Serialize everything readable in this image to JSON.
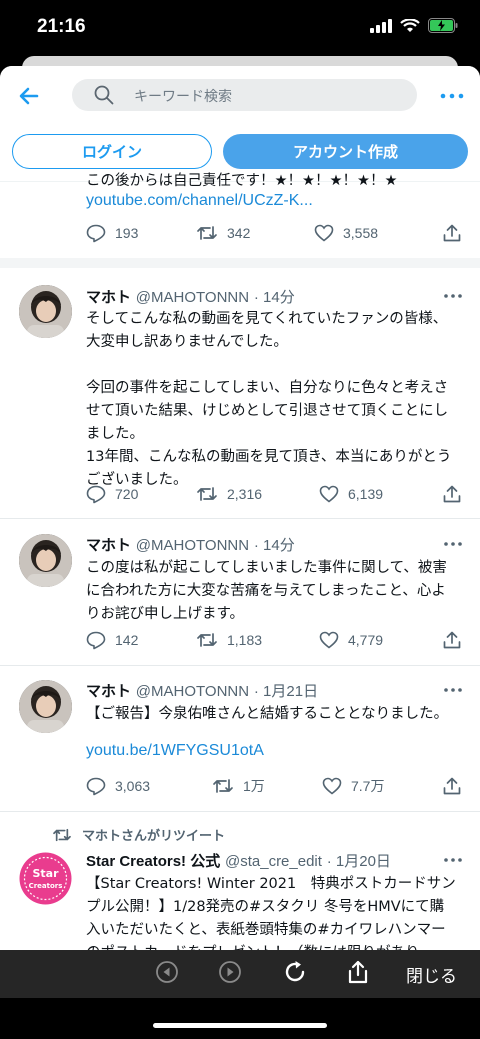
{
  "status_bar": {
    "time": "21:16"
  },
  "header": {
    "search_placeholder": "キーワード検索"
  },
  "auth": {
    "login_label": "ログイン",
    "signup_label": "アカウント作成"
  },
  "partial_tweet": {
    "text_fragment": "この後からは自己責任です！★！★！★！★！★",
    "link": "youtube.com/channel/UCzZ-K...",
    "replies": "193",
    "retweets": "342",
    "likes": "3,558"
  },
  "tweets": [
    {
      "name": "マホト",
      "handle": "@MAHOTONNN",
      "time": "· 14分",
      "text": "そしてこんな私の動画を見てくれていたファンの皆様、大変申し訳ありませんでした。\n\n今回の事件を起こしてしまい、自分なりに色々と考えさせて頂いた結果、けじめとして引退させて頂くことにしました。\n13年間、こんな私の動画を見て頂き、本当にありがとうございました。",
      "replies": "720",
      "retweets": "2,316",
      "likes": "6,139"
    },
    {
      "name": "マホト",
      "handle": "@MAHOTONNN",
      "time": "· 14分",
      "text": "この度は私が起こしてしまいました事件に関して、被害に合われた方に大変な苦痛を与えてしまったこと、心よりお詫び申し上げます。",
      "replies": "142",
      "retweets": "1,183",
      "likes": "4,779"
    },
    {
      "name": "マホト",
      "handle": "@MAHOTONNN",
      "time": "· 1月21日",
      "text": "【ご報告】今泉佑唯さんと結婚することとなりました。",
      "link": "youtu.be/1WFYGSU1otA",
      "replies": "3,063",
      "retweets": "1万",
      "likes": "7.7万"
    },
    {
      "retweet_note": "マホトさんがリツイート",
      "name": "Star Creators! 公式",
      "handle": "@sta_cre_edit",
      "time": "· 1月20日",
      "avatar_text": "Star Creators",
      "text": "【Star Creators! Winter 2021　特典ポストカードサンプル公開！】1/28発売の#スタクリ 冬号をHMVにて購入いただいたくと、表紙巻頭特集の#カイワレハンマー のポストカードをプレゼント！（数には限りがあり"
    }
  ],
  "toolbar": {
    "close_label": "閉じる"
  },
  "colors": {
    "accent": "#1d9bf0",
    "link": "#1b8ad8",
    "signup": "#4aa3ea",
    "toolbar": "#262626"
  }
}
